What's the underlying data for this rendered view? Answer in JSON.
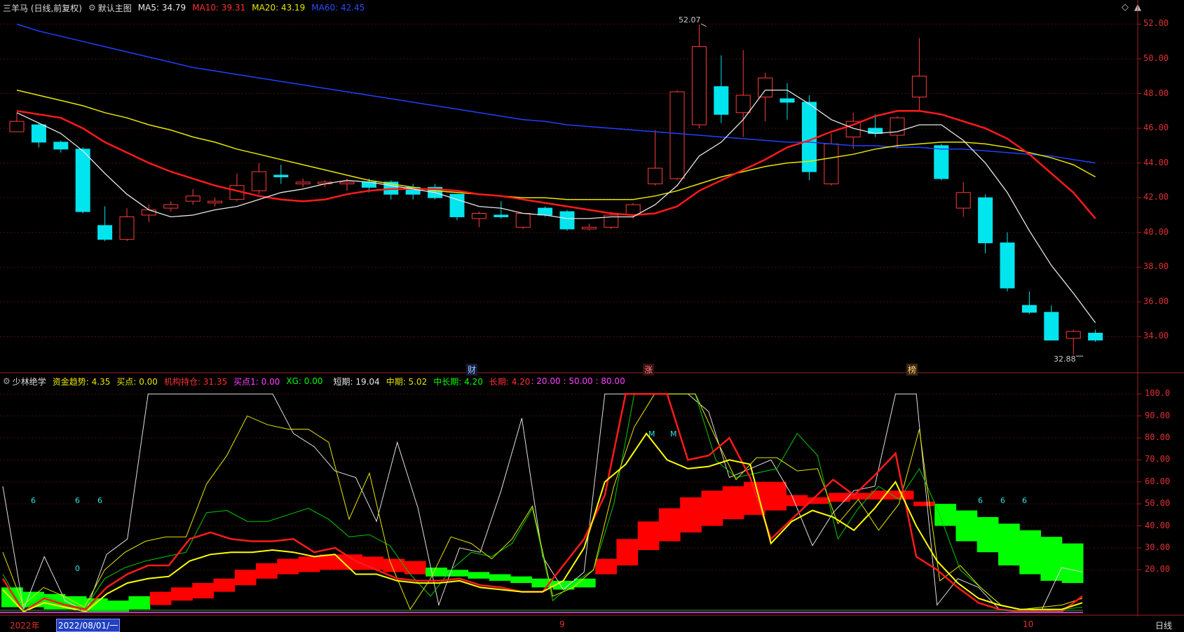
{
  "main_header": {
    "title": "三羊马 (日线,前复权)",
    "chart_name": "默认主图",
    "ma5": "MA5: 34.79",
    "ma10": "MA10: 39.31",
    "ma20": "MA20: 43.19",
    "ma60": "MA60: 42.45"
  },
  "indicator_header": {
    "name": "少林绝学",
    "fund_trend": "资金趋势: 4.35",
    "buy_point": "买点: 0.00",
    "institution": "机构持仓: 31.35",
    "buy_point1": "买点1: 0.00",
    "xg": "XG: 0.00",
    "short_term": "短期: 19.04",
    "mid_term": "中期: 5.02",
    "mid_long_term": "中长期: 4.20",
    "long_term": "长期: 4.20",
    "levels": ": 20.00 : 50.00 : 80.00"
  },
  "price_axis": [
    "52.00",
    "50.00",
    "48.00",
    "46.00",
    "44.00",
    "42.00",
    "40.00",
    "38.00",
    "36.00",
    "34.00"
  ],
  "indicator_axis": [
    "100.0",
    "90.00",
    "80.00",
    "70.00",
    "60.00",
    "50.00",
    "40.00",
    "30.00",
    "20.00"
  ],
  "annotations": {
    "high": "52.07",
    "low": "32.88"
  },
  "events": {
    "cai": "财",
    "zhang": "涨",
    "bang": "榜"
  },
  "signals": {
    "six": "6",
    "zero": "0",
    "m": "M"
  },
  "bottom_bar": {
    "year": "2022年",
    "date": "2022/08/01/一",
    "month9": "9",
    "month10": "10",
    "period": "日线"
  },
  "colors": {
    "up": "#ff3b3b",
    "down": "#00e5ee",
    "ma5": "#e8e8e8",
    "ma10": "#ff1a1a",
    "ma20": "#e6e600",
    "ma60": "#2040ff"
  },
  "chart_data": {
    "type": "candlestick",
    "ylim": [
      32,
      52.5
    ],
    "candles": [
      [
        45.8,
        46.4,
        45.8,
        46.9
      ],
      [
        46.2,
        45.2,
        44.9,
        46.3
      ],
      [
        45.2,
        44.8,
        44.6,
        45.3
      ],
      [
        44.8,
        41.2,
        41.1,
        44.9
      ],
      [
        40.4,
        39.6,
        39.5,
        41.5
      ],
      [
        39.6,
        40.9,
        39.5,
        41.4
      ],
      [
        41.0,
        41.3,
        40.6,
        41.6
      ],
      [
        41.4,
        41.6,
        41.2,
        41.8
      ],
      [
        41.8,
        42.1,
        41.6,
        42.5
      ],
      [
        41.7,
        41.8,
        41.5,
        42.0
      ],
      [
        41.9,
        42.7,
        41.8,
        43.4
      ],
      [
        42.4,
        43.5,
        42.2,
        44.0
      ],
      [
        43.3,
        43.2,
        42.8,
        43.9
      ],
      [
        42.8,
        42.9,
        42.6,
        43.1
      ],
      [
        42.8,
        42.9,
        42.6,
        43.0
      ],
      [
        42.8,
        42.9,
        42.4,
        43.1
      ],
      [
        42.9,
        42.6,
        42.3,
        43.1
      ],
      [
        42.9,
        42.2,
        41.9,
        43.0
      ],
      [
        42.6,
        42.2,
        41.9,
        42.8
      ],
      [
        42.6,
        42.0,
        41.9,
        42.8
      ],
      [
        42.2,
        40.9,
        40.7,
        42.2
      ],
      [
        40.8,
        41.1,
        40.3,
        41.2
      ],
      [
        41.0,
        40.9,
        40.8,
        41.8
      ],
      [
        40.3,
        41.1,
        40.2,
        41.1
      ],
      [
        41.4,
        41.0,
        40.9,
        41.5
      ],
      [
        41.2,
        40.2,
        40.1,
        41.3
      ],
      [
        40.2,
        40.3,
        40.1,
        40.5
      ],
      [
        40.3,
        41.0,
        40.2,
        41.2
      ],
      [
        41.0,
        41.6,
        40.8,
        41.7
      ],
      [
        42.8,
        43.7,
        42.7,
        45.9
      ],
      [
        43.1,
        48.1,
        43.0,
        48.2
      ],
      [
        46.2,
        50.7,
        46.0,
        52.1
      ],
      [
        48.4,
        46.8,
        46.3,
        50.2
      ],
      [
        46.9,
        47.9,
        45.5,
        50.5
      ],
      [
        47.8,
        48.9,
        46.4,
        49.2
      ],
      [
        47.7,
        47.5,
        46.5,
        48.6
      ],
      [
        47.5,
        43.5,
        43.0,
        47.9
      ],
      [
        42.8,
        45.1,
        42.7,
        45.7
      ],
      [
        45.5,
        46.4,
        44.8,
        46.9
      ],
      [
        46.0,
        45.7,
        45.5,
        46.8
      ],
      [
        45.6,
        46.6,
        44.8,
        46.7
      ],
      [
        47.8,
        49.0,
        47.0,
        51.2
      ],
      [
        45.0,
        43.1,
        43.0,
        45.1
      ],
      [
        41.4,
        42.3,
        40.9,
        42.9
      ],
      [
        42.0,
        39.4,
        38.8,
        42.2
      ],
      [
        39.4,
        36.8,
        36.6,
        40.0
      ],
      [
        35.8,
        35.4,
        35.3,
        36.6
      ],
      [
        35.4,
        33.8,
        33.8,
        35.8
      ],
      [
        33.9,
        34.3,
        32.9,
        34.4
      ],
      [
        34.2,
        33.8,
        33.7,
        34.4
      ]
    ],
    "ma5": [
      46.9,
      46.3,
      45.7,
      44.7,
      43.4,
      42.2,
      41.3,
      40.9,
      41.0,
      41.3,
      41.5,
      41.9,
      42.3,
      42.5,
      42.8,
      43.0,
      42.9,
      42.7,
      42.5,
      42.3,
      41.9,
      41.5,
      41.4,
      41.1,
      41.0,
      40.8,
      40.8,
      40.9,
      40.9,
      41.6,
      42.7,
      44.4,
      45.2,
      46.5,
      48.2,
      48.2,
      47.4,
      46.5,
      46.0,
      45.7,
      45.8,
      46.2,
      46.2,
      45.3,
      44.0,
      42.3,
      40.1,
      38.1,
      36.5,
      34.8
    ],
    "ma10": [
      47.0,
      46.8,
      46.6,
      46.0,
      45.2,
      44.6,
      44.0,
      43.5,
      43.1,
      42.7,
      42.4,
      42.1,
      41.9,
      41.8,
      41.9,
      42.2,
      42.4,
      42.5,
      42.5,
      42.5,
      42.4,
      42.2,
      42.1,
      41.9,
      41.7,
      41.5,
      41.3,
      41.1,
      41.0,
      41.1,
      41.5,
      42.4,
      43.0,
      43.6,
      44.2,
      44.9,
      45.3,
      45.8,
      46.2,
      46.7,
      47.0,
      47.0,
      46.8,
      46.4,
      46.0,
      45.4,
      44.5,
      43.4,
      42.3,
      40.8
    ],
    "ma20": [
      48.2,
      47.9,
      47.6,
      47.3,
      46.9,
      46.6,
      46.2,
      45.9,
      45.5,
      45.2,
      44.8,
      44.5,
      44.2,
      43.9,
      43.6,
      43.3,
      43.0,
      42.8,
      42.6,
      42.4,
      42.3,
      42.2,
      42.1,
      42.0,
      42.0,
      41.9,
      41.9,
      41.9,
      41.9,
      42.1,
      42.4,
      42.8,
      43.2,
      43.5,
      43.8,
      44.0,
      44.1,
      44.3,
      44.5,
      44.8,
      45.0,
      45.1,
      45.2,
      45.2,
      45.1,
      44.9,
      44.6,
      44.3,
      43.9,
      43.2
    ],
    "ma60": [
      52.0,
      51.6,
      51.3,
      51.0,
      50.7,
      50.4,
      50.1,
      49.8,
      49.5,
      49.3,
      49.1,
      48.9,
      48.7,
      48.5,
      48.3,
      48.1,
      47.9,
      47.7,
      47.5,
      47.3,
      47.1,
      46.9,
      46.7,
      46.5,
      46.4,
      46.2,
      46.1,
      46.0,
      45.9,
      45.8,
      45.7,
      45.6,
      45.5,
      45.4,
      45.3,
      45.2,
      45.2,
      45.1,
      45.0,
      45.0,
      44.9,
      44.9,
      44.8,
      44.8,
      44.7,
      44.6,
      44.5,
      44.4,
      44.2,
      44.0
    ],
    "indicator": {
      "ylim": [
        0,
        102
      ],
      "institution_blocks": [
        [
          3,
          12,
          "#00ff00"
        ],
        [
          3,
          10,
          "#00ff00"
        ],
        [
          2,
          9,
          "#00ff00"
        ],
        [
          2,
          8,
          "#00ff00"
        ],
        [
          1,
          7,
          "#00ff00"
        ],
        [
          1,
          6,
          "#00ff00"
        ],
        [
          2,
          8,
          "#00ff00"
        ],
        [
          4,
          10,
          "#ff0000"
        ],
        [
          6,
          12,
          "#ff0000"
        ],
        [
          7,
          14,
          "#ff0000"
        ],
        [
          10,
          16,
          "#ff0000"
        ],
        [
          13,
          20,
          "#ff0000"
        ],
        [
          16,
          23,
          "#ff0000"
        ],
        [
          18,
          25,
          "#ff0000"
        ],
        [
          19,
          26,
          "#ff0000"
        ],
        [
          20,
          27,
          "#ff0000"
        ],
        [
          20,
          27,
          "#ff0000"
        ],
        [
          20,
          26,
          "#ff0000"
        ],
        [
          19,
          25,
          "#ff0000"
        ],
        [
          18,
          24,
          "#ff0000"
        ],
        [
          17,
          21,
          "#00ff00"
        ],
        [
          17,
          20,
          "#00ff00"
        ],
        [
          16,
          19,
          "#00ff00"
        ],
        [
          15,
          18,
          "#00ff00"
        ],
        [
          14,
          17,
          "#00ff00"
        ],
        [
          12,
          16,
          "#00ff00"
        ],
        [
          11,
          15,
          "#00ff00"
        ],
        [
          12,
          16,
          "#00ff00"
        ],
        [
          18,
          25,
          "#ff0000"
        ],
        [
          22,
          34,
          "#ff0000"
        ],
        [
          29,
          42,
          "#ff0000"
        ],
        [
          33,
          48,
          "#ff0000"
        ],
        [
          37,
          53,
          "#ff0000"
        ],
        [
          40,
          56,
          "#ff0000"
        ],
        [
          43,
          58,
          "#ff0000"
        ],
        [
          45,
          60,
          "#ff0000"
        ],
        [
          47,
          60,
          "#ff0000"
        ],
        [
          49,
          54,
          "#ff0000"
        ],
        [
          50,
          53,
          "#ff0000"
        ],
        [
          51,
          55,
          "#ff0000"
        ],
        [
          52,
          55,
          "#ff0000"
        ],
        [
          52,
          56,
          "#ff0000"
        ],
        [
          52,
          56,
          "#ff0000"
        ],
        [
          49,
          51,
          "#ff0000"
        ],
        [
          40,
          50,
          "#00ff00"
        ],
        [
          33,
          47,
          "#00ff00"
        ],
        [
          28,
          44,
          "#00ff00"
        ],
        [
          22,
          41,
          "#00ff00"
        ],
        [
          18,
          38,
          "#00ff00"
        ],
        [
          15,
          35,
          "#00ff00"
        ],
        [
          14,
          32,
          "#00ff00"
        ]
      ],
      "white": [
        58,
        2,
        26,
        6,
        1,
        27,
        34,
        100,
        100,
        100,
        100,
        100,
        100,
        100,
        82,
        76,
        65,
        62,
        42,
        78,
        48,
        4,
        30,
        28,
        56,
        89,
        26,
        11,
        19,
        100,
        100,
        100,
        100,
        100,
        92,
        62,
        66,
        70,
        54,
        31,
        46,
        56,
        58,
        100,
        100,
        4,
        16,
        12,
        2,
        1,
        1,
        21,
        19
      ],
      "yellow": [
        28,
        4,
        12,
        8,
        3,
        20,
        28,
        33,
        35,
        35,
        59,
        72,
        90,
        86,
        84,
        84,
        78,
        43,
        64,
        24,
        2,
        16,
        35,
        32,
        25,
        34,
        49,
        8,
        12,
        20,
        58,
        85,
        100,
        100,
        100,
        80,
        61,
        71,
        71,
        65,
        66,
        41,
        52,
        38,
        50,
        84,
        15,
        22,
        12,
        4,
        2,
        3,
        4,
        7
      ],
      "green": [
        18,
        2,
        8,
        5,
        2,
        16,
        21,
        24,
        26,
        28,
        46,
        47,
        42,
        42,
        45,
        48,
        43,
        35,
        36,
        31,
        18,
        8,
        20,
        28,
        26,
        32,
        48,
        6,
        14,
        20,
        50,
        100,
        100,
        100,
        100,
        70,
        62,
        64,
        66,
        82,
        72,
        34,
        48,
        58,
        52,
        66,
        45,
        20,
        12,
        4,
        2,
        1,
        2,
        3
      ],
      "red": [
        16,
        1,
        7,
        4,
        2,
        12,
        18,
        22,
        22,
        34,
        37,
        34,
        33,
        33,
        34,
        28,
        30,
        24,
        20,
        16,
        15,
        15,
        16,
        13,
        12,
        10,
        10,
        22,
        34,
        54,
        100,
        100,
        100,
        70,
        72,
        80,
        62,
        34,
        43,
        52,
        61,
        54,
        63,
        73,
        26,
        20,
        12,
        5,
        2,
        1,
        1,
        1,
        8
      ],
      "yellow2": [
        11,
        1,
        5,
        3,
        1,
        9,
        14,
        16,
        17,
        24,
        27,
        28,
        28,
        29,
        28,
        26,
        27,
        18,
        18,
        15,
        14,
        14,
        15,
        12,
        11,
        10,
        10,
        15,
        30,
        60,
        68,
        82,
        70,
        66,
        67,
        70,
        68,
        32,
        42,
        47,
        44,
        38,
        48,
        60,
        40,
        24,
        14,
        7,
        4,
        2,
        2,
        2,
        5
      ]
    }
  }
}
